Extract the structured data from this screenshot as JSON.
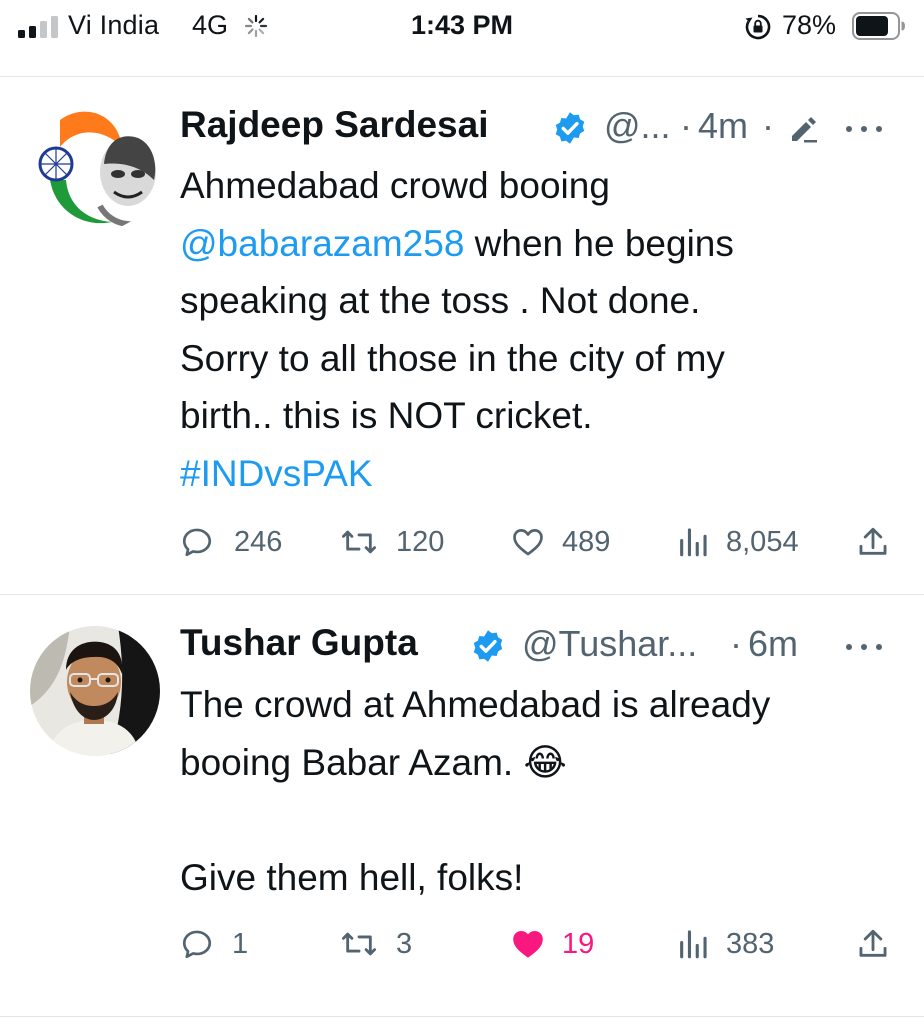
{
  "status_bar": {
    "carrier": "Vi India",
    "network": "4G",
    "time": "1:43 PM",
    "battery_percent": "78%",
    "signal_bars_filled": 2,
    "signal_bars_total": 4
  },
  "tweets": [
    {
      "name": "Rajdeep Sardesai",
      "handle": "@...",
      "time": "4m",
      "separator": "·",
      "edited": true,
      "verified": true,
      "text": {
        "line1": "Ahmedabad crowd booing",
        "mention": "@babarazam258",
        "line2_rest": " when he begins",
        "line3": "speaking at the toss . Not done.",
        "line4": "Sorry to all those in the city of my",
        "line5": "birth.. this is NOT cricket.",
        "hashtag": "#INDvsPAK"
      },
      "stats": {
        "replies": "246",
        "retweets": "120",
        "likes": "489",
        "views": "8,054"
      },
      "liked": false
    },
    {
      "name": "Tushar Gupta",
      "handle": "@Tushar...",
      "time": "6m",
      "separator": "·",
      "verified": true,
      "text": {
        "line1": "The crowd at Ahmedabad is already",
        "line2": "booing Babar Azam.",
        "emoji": "😂",
        "line3": "Give them hell, folks!"
      },
      "stats": {
        "replies": "1",
        "retweets": "3",
        "likes": "19",
        "views": "383"
      },
      "liked": true
    }
  ],
  "colors": {
    "link": "#1d9bf0",
    "verified": "#1d9bf0",
    "like_active": "#f91880",
    "muted": "#536471",
    "text": "#0f1419"
  },
  "icons": [
    "reply-icon",
    "retweet-icon",
    "like-icon",
    "views-icon",
    "share-icon",
    "verified-badge-icon",
    "more-icon",
    "edit-icon"
  ]
}
